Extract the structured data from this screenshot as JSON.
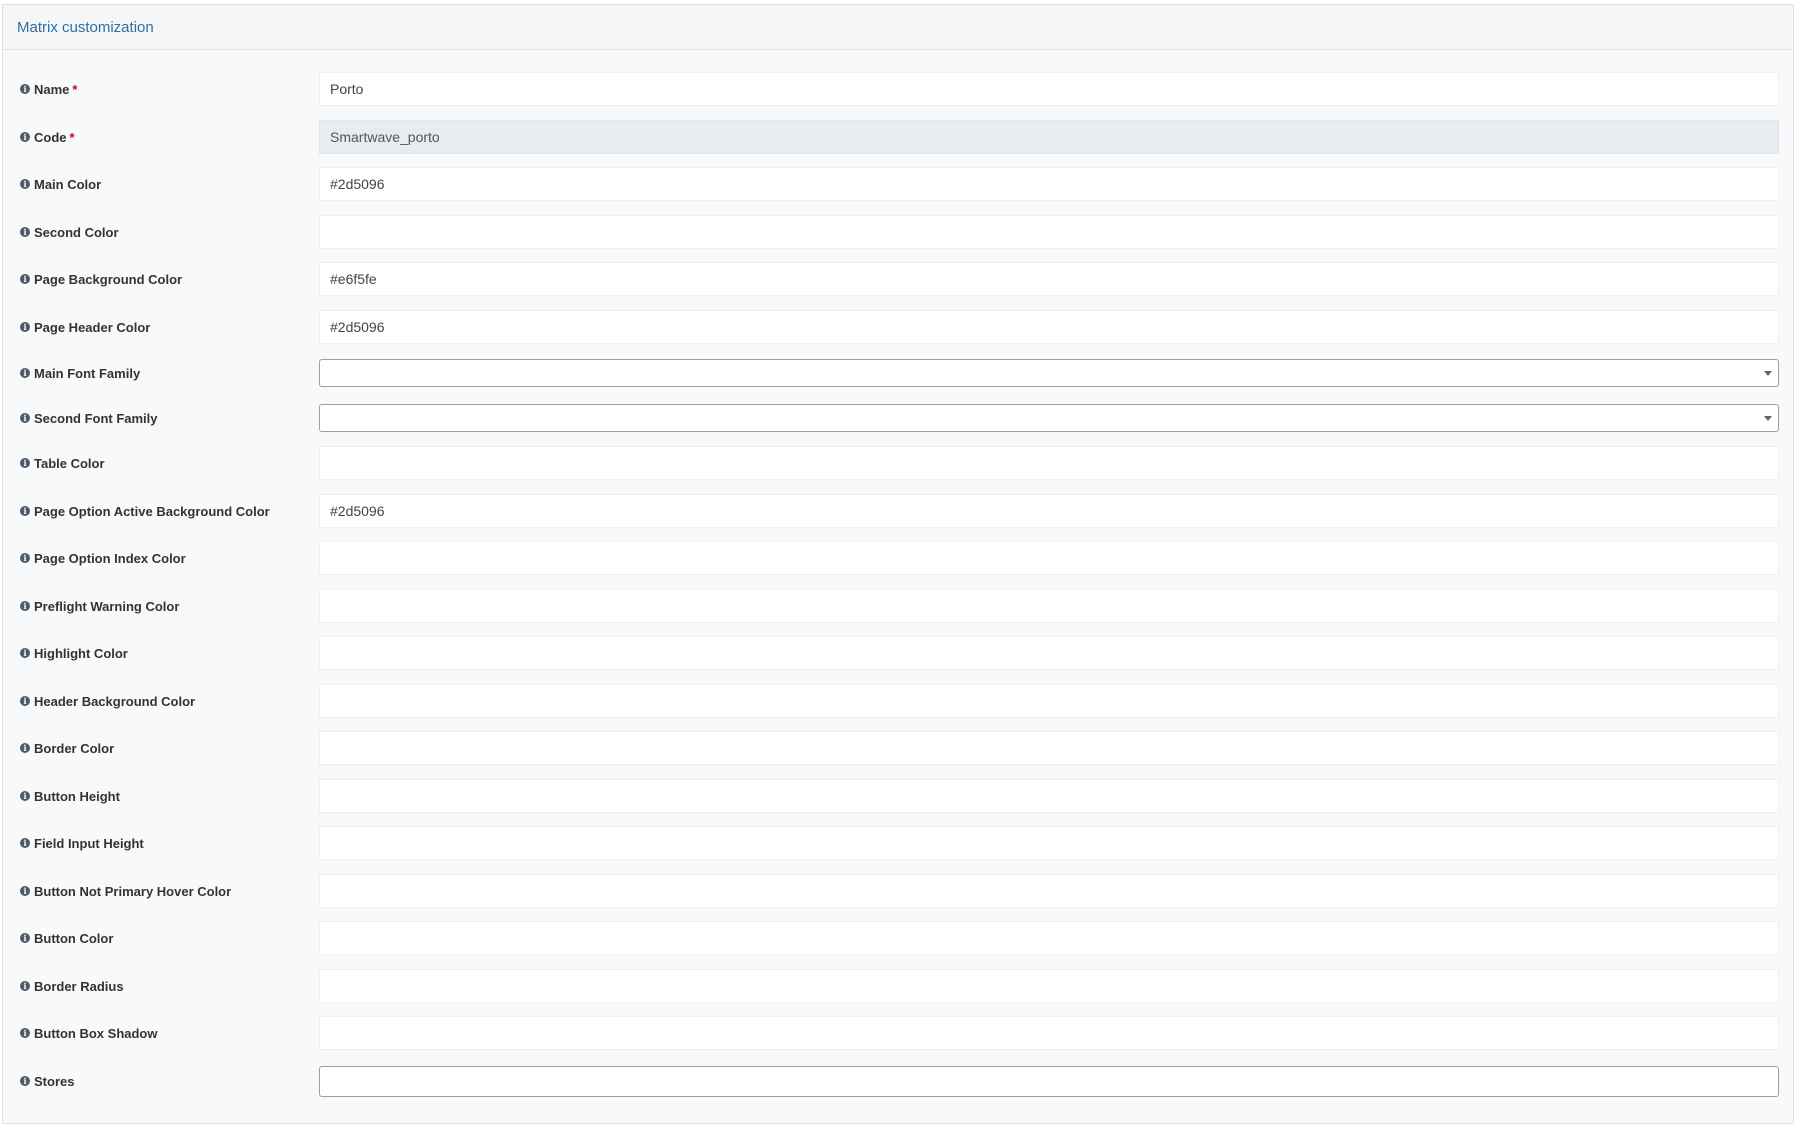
{
  "panel": {
    "title": "Matrix customization"
  },
  "fields": [
    {
      "label": "Name",
      "required": "*",
      "value": "Porto"
    },
    {
      "label": "Code",
      "required": "*",
      "value": "Smartwave_porto"
    },
    {
      "label": "Main Color",
      "value": "#2d5096"
    },
    {
      "label": "Second Color",
      "value": ""
    },
    {
      "label": "Page Background Color",
      "value": "#e6f5fe"
    },
    {
      "label": "Page Header Color",
      "value": "#2d5096"
    },
    {
      "label": "Main Font Family",
      "value": ""
    },
    {
      "label": "Second Font Family",
      "value": ""
    },
    {
      "label": "Table Color",
      "value": ""
    },
    {
      "label": "Page Option Active Background Color",
      "value": "#2d5096"
    },
    {
      "label": "Page Option Index Color",
      "value": ""
    },
    {
      "label": "Preflight Warning Color",
      "value": ""
    },
    {
      "label": "Highlight Color",
      "value": ""
    },
    {
      "label": "Header Background Color",
      "value": ""
    },
    {
      "label": "Border Color",
      "value": ""
    },
    {
      "label": "Button Height",
      "value": ""
    },
    {
      "label": "Field Input Height",
      "value": ""
    },
    {
      "label": "Button Not Primary Hover Color",
      "value": ""
    },
    {
      "label": "Button Color",
      "value": ""
    },
    {
      "label": "Border Radius",
      "value": ""
    },
    {
      "label": "Button Box Shadow",
      "value": ""
    },
    {
      "label": "Stores",
      "value": ""
    }
  ],
  "icons": {
    "info": "info-icon",
    "dropdown": "chevron-down-icon"
  },
  "colors": {
    "title": "#2d6fa5",
    "required": "#d0021b",
    "panel_bg": "#f8f9fa"
  }
}
